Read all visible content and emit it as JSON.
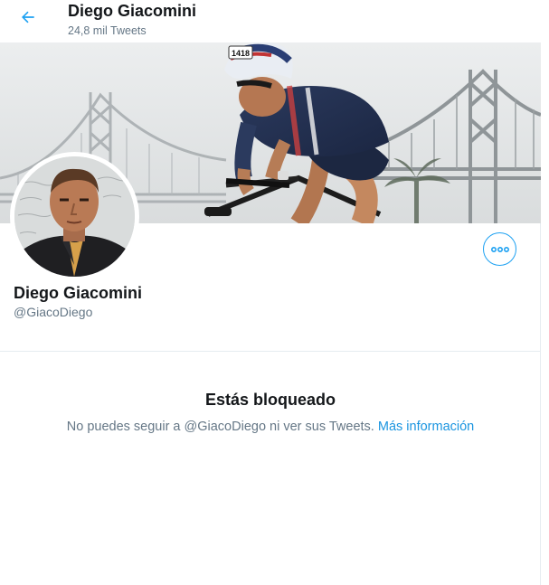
{
  "header": {
    "back_icon": "arrow-left-icon",
    "name": "Diego Giacomini",
    "tweet_count": "24,8 mil Tweets"
  },
  "profile": {
    "name": "Diego Giacomini",
    "handle": "@GiacoDiego",
    "banner_bib": "1418",
    "more_icon": "more-horizontal-icon"
  },
  "blocked": {
    "title": "Estás bloqueado",
    "message": "No puedes seguir a @GiacoDiego ni ver sus Tweets. ",
    "link": "Más información"
  },
  "colors": {
    "accent": "#1da1f2",
    "link": "#1b95e0",
    "secondary_text": "#657786",
    "divider": "#e6ecf0"
  }
}
